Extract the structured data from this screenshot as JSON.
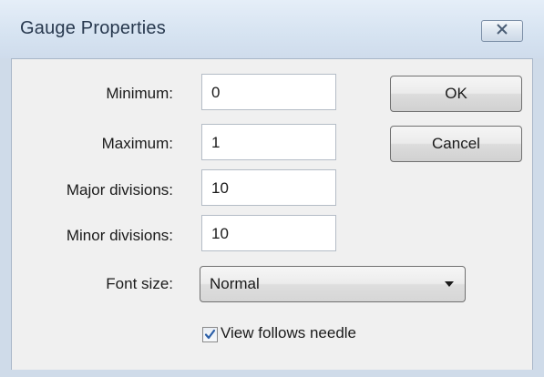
{
  "window": {
    "title": "Gauge Properties",
    "close_icon": "close-x-icon"
  },
  "fields": {
    "minimum": {
      "label": "Minimum:",
      "value": "0"
    },
    "maximum": {
      "label": "Maximum:",
      "value": "1"
    },
    "major_divisions": {
      "label": "Major divisions:",
      "value": "10"
    },
    "minor_divisions": {
      "label": "Minor divisions:",
      "value": "10"
    }
  },
  "font_size": {
    "label": "Font size:",
    "selected": "Normal"
  },
  "view_follows_needle": {
    "label": "View follows needle",
    "checked": true
  },
  "buttons": {
    "ok": "OK",
    "cancel": "Cancel"
  },
  "colors": {
    "title_bar": "#d6e3f1",
    "dialog_background": "#f0f0f0",
    "check_mark": "#2c5fa8"
  }
}
